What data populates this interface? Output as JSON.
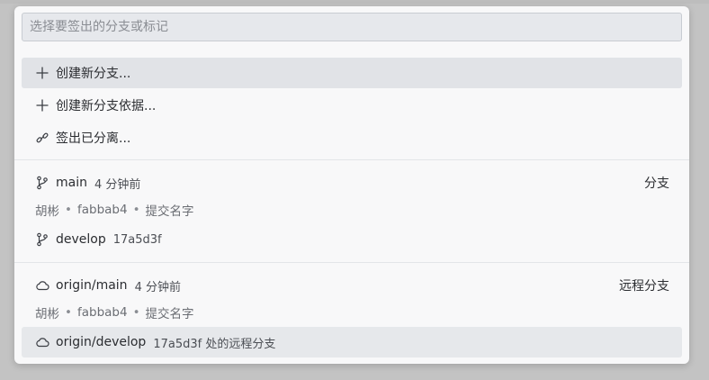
{
  "search": {
    "placeholder": "选择要签出的分支或标记",
    "value": ""
  },
  "actions": [
    {
      "label": "创建新分支...",
      "icon": "plus-icon"
    },
    {
      "label": "创建新分支依据...",
      "icon": "plus-icon"
    },
    {
      "label": "签出已分离...",
      "icon": "detach-icon"
    }
  ],
  "branches": {
    "group_label": "分支",
    "items": [
      {
        "name": "main",
        "description": "4 分钟前",
        "author": "胡彬",
        "commit": "fabbab4",
        "message": "提交名字",
        "icon": "git-branch-icon"
      },
      {
        "name": "develop",
        "description": "17a5d3f",
        "icon": "git-branch-icon"
      }
    ]
  },
  "remote_branches": {
    "group_label": "远程分支",
    "items": [
      {
        "name": "origin/main",
        "description": "4 分钟前",
        "author": "胡彬",
        "commit": "fabbab4",
        "message": "提交名字",
        "icon": "cloud-icon"
      },
      {
        "name": "origin/develop",
        "description": "17a5d3f 处的远程分支",
        "icon": "cloud-icon"
      }
    ]
  },
  "detail_separator": "•"
}
